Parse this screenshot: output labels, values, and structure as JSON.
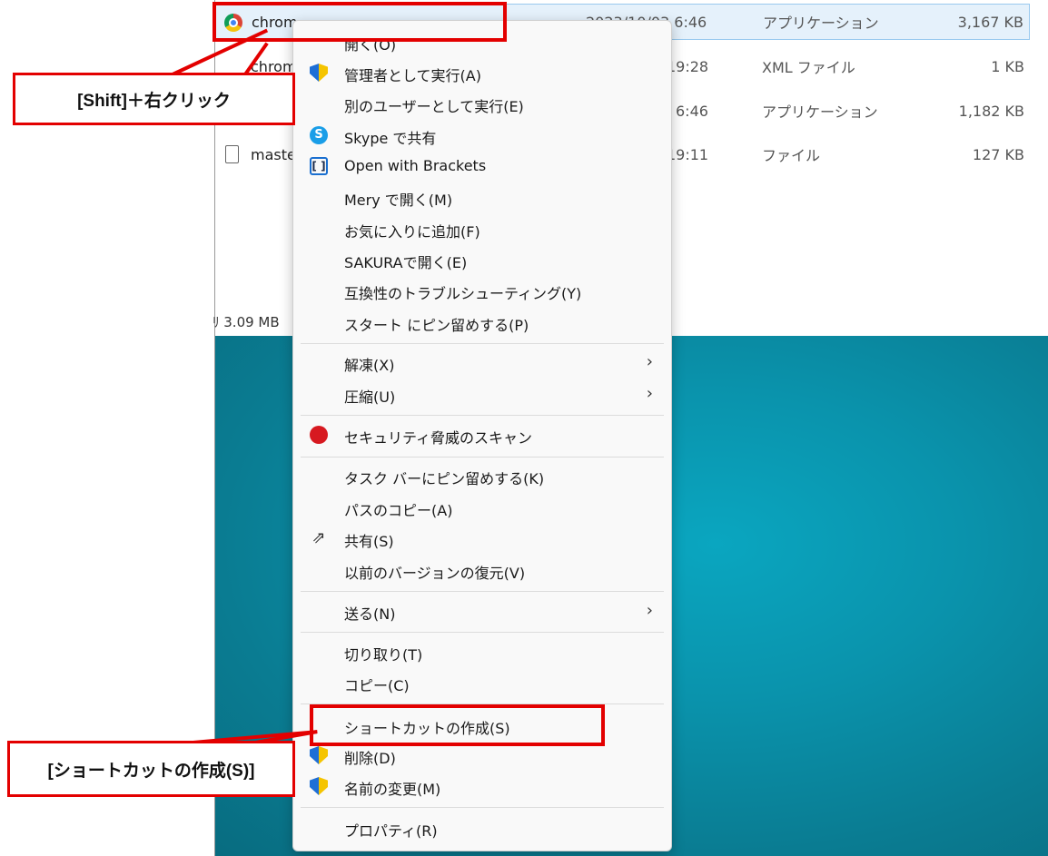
{
  "explorer": {
    "files": [
      {
        "name": "chrom",
        "date": "2023/10/03 6:46",
        "type": "アプリケーション",
        "size": "3,167 KB",
        "icon": "chrome-icon"
      },
      {
        "name": "chrom",
        "date": "19:28",
        "type": "XML ファイル",
        "size": "1 KB",
        "icon": "chrome-icon"
      },
      {
        "name": "",
        "date": "6:46",
        "type": "アプリケーション",
        "size": "1,182 KB",
        "icon": ""
      },
      {
        "name": "maste",
        "date": "19:11",
        "type": "ファイル",
        "size": "127 KB",
        "icon": "file-icon"
      }
    ],
    "status": "ﾘ 3.09 MB"
  },
  "menu": {
    "items": [
      {
        "label": "開く(O)"
      },
      {
        "label": "管理者として実行(A)",
        "icon": "shield-icon"
      },
      {
        "label": "別のユーザーとして実行(E)"
      },
      {
        "label": "Skype で共有",
        "icon": "skype-icon"
      },
      {
        "label": "Open with Brackets",
        "icon": "brackets-icon"
      },
      {
        "label": "Mery で開く(M)"
      },
      {
        "label": "お気に入りに追加(F)"
      },
      {
        "label": "SAKURAで開く(E)"
      },
      {
        "label": "互換性のトラブルシューティング(Y)"
      },
      {
        "label": "スタート にピン留めする(P)"
      },
      {
        "label": "解凍(X)",
        "submenu": true
      },
      {
        "label": "圧縮(U)",
        "submenu": true
      },
      {
        "label": "セキュリティ脅威のスキャン",
        "icon": "trend-icon"
      },
      {
        "label": "タスク バーにピン留めする(K)"
      },
      {
        "label": "パスのコピー(A)"
      },
      {
        "label": "共有(S)",
        "icon": "share-icon"
      },
      {
        "label": "以前のバージョンの復元(V)"
      },
      {
        "label": "送る(N)",
        "submenu": true
      },
      {
        "label": "切り取り(T)"
      },
      {
        "label": "コピー(C)"
      },
      {
        "label": "ショートカットの作成(S)"
      },
      {
        "label": "削除(D)",
        "icon": "shield-icon"
      },
      {
        "label": "名前の変更(M)",
        "icon": "shield-icon"
      },
      {
        "label": "プロパティ(R)"
      }
    ],
    "submenu_arrow": "›"
  },
  "annotations": {
    "shift_click": "[Shift]＋右クリック",
    "create_shortcut": "[ショートカットの作成(S)]",
    "highlight_color": "#e30000"
  }
}
